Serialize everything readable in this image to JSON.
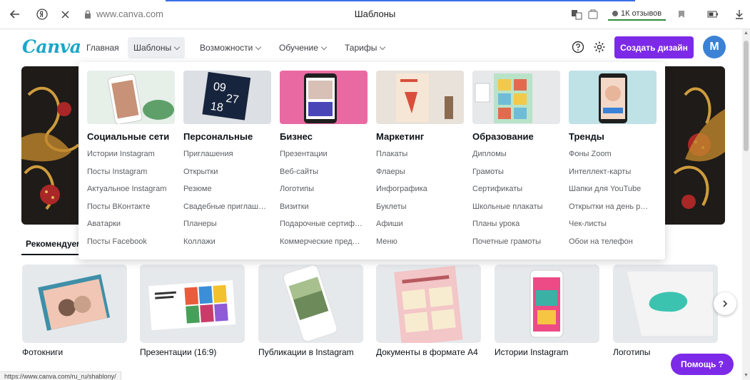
{
  "browser": {
    "url": "www.canva.com",
    "tab_title": "Шаблоны",
    "reviews": "1К отзывов",
    "status_url": "https://www.canva.com/ru_ru/shablony/"
  },
  "header": {
    "logo": "Canva",
    "nav": [
      {
        "label": "Главная"
      },
      {
        "label": "Шаблоны"
      },
      {
        "label": "Возможности"
      },
      {
        "label": "Обучение"
      },
      {
        "label": "Тарифы"
      }
    ],
    "create_button": "Создать дизайн",
    "avatar_initial": "M",
    "accent_color": "#7d2ae8"
  },
  "mega_menu": {
    "columns": [
      {
        "title": "Социальные сети",
        "items": [
          "Истории Instagram",
          "Посты Instagram",
          "Актуальное Instagram",
          "Посты ВКонтакте",
          "Аватарки",
          "Посты Facebook"
        ]
      },
      {
        "title": "Персональные",
        "items": [
          "Приглашения",
          "Открытки",
          "Резюме",
          "Свадебные приглаш…",
          "Планеры",
          "Коллажи"
        ]
      },
      {
        "title": "Бизнес",
        "items": [
          "Презентации",
          "Веб-сайты",
          "Логотипы",
          "Визитки",
          "Подарочные сертиф…",
          "Коммерческие пред…"
        ]
      },
      {
        "title": "Маркетинг",
        "items": [
          "Плакаты",
          "Флаеры",
          "Инфографика",
          "Буклеты",
          "Афиши",
          "Меню"
        ]
      },
      {
        "title": "Образование",
        "items": [
          "Дипломы",
          "Грамоты",
          "Сертификаты",
          "Школьные плакаты",
          "Планы урока",
          "Почетные грамоты"
        ]
      },
      {
        "title": "Тренды",
        "items": [
          "Фоны Zoom",
          "Интеллект-карты",
          "Шапки для YouTube",
          "Открытки на день р…",
          "Чек-листы",
          "Обои на телефон"
        ]
      }
    ]
  },
  "recommended_tab": "Рекомендуем",
  "cards": [
    {
      "label": "Фотокниги"
    },
    {
      "label": "Презентации (16:9)"
    },
    {
      "label": "Публикации в Instagram"
    },
    {
      "label": "Документы в формате А4"
    },
    {
      "label": "Истории Instagram"
    },
    {
      "label": "Логотипы"
    }
  ],
  "help_button": "Помощь ?"
}
